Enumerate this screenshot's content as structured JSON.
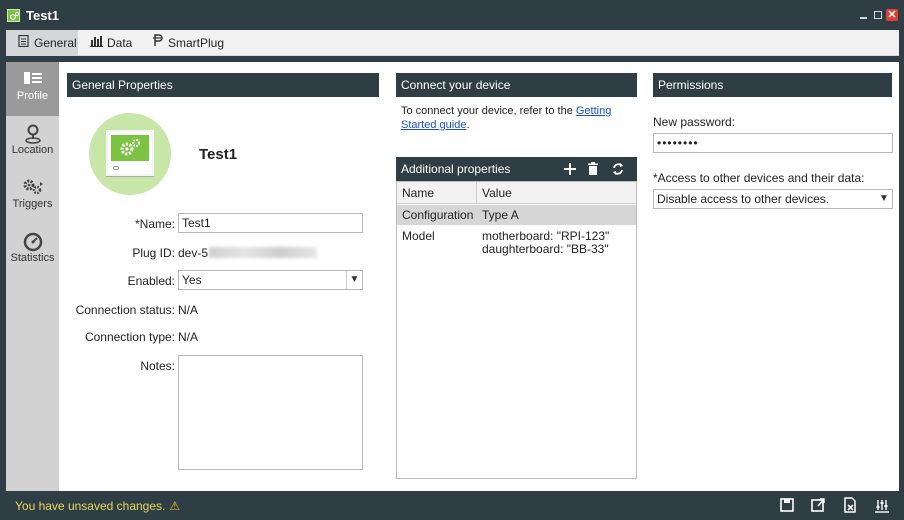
{
  "window": {
    "title": "Test1"
  },
  "top_tabs": [
    {
      "label": "General",
      "icon": "document-icon",
      "active": true
    },
    {
      "label": "Data",
      "icon": "bar-chart-icon",
      "active": false
    },
    {
      "label": "SmartPlug",
      "icon": "smartplug-icon",
      "active": false
    }
  ],
  "sidebar": {
    "items": [
      {
        "label": "Profile",
        "icon": "profile-icon",
        "active": true
      },
      {
        "label": "Location",
        "icon": "location-pin-icon",
        "active": false
      },
      {
        "label": "Triggers",
        "icon": "gears-icon",
        "active": false
      },
      {
        "label": "Statistics",
        "icon": "gauge-icon",
        "active": false
      }
    ]
  },
  "general": {
    "header": "General Properties",
    "device_name": "Test1",
    "name_label": "*Name:",
    "name_value": "Test1",
    "plug_id_label": "Plug ID:",
    "plug_id_value": "dev-5",
    "enabled_label": "Enabled:",
    "enabled_value": "Yes",
    "conn_status_label": "Connection status:",
    "conn_status_value": "N/A",
    "conn_type_label": "Connection type:",
    "conn_type_value": "N/A",
    "notes_label": "Notes:",
    "notes_value": ""
  },
  "connect": {
    "header": "Connect your device",
    "text_before": "To connect your device, refer to the ",
    "link": "Getting Started guide",
    "text_after": "."
  },
  "additional": {
    "header": "Additional properties",
    "columns": [
      "Name",
      "Value"
    ],
    "rows": [
      {
        "name": "Configuration",
        "value_lines": [
          "Type A"
        ]
      },
      {
        "name": "Model",
        "value_lines": [
          "motherboard: \"RPI-123\"",
          "daughterboard: \"BB-33\""
        ]
      }
    ]
  },
  "permissions": {
    "header": "Permissions",
    "password_label": "New password:",
    "password_value": "••••••••",
    "access_label": "*Access to other devices and their data:",
    "access_value": "Disable access to other devices."
  },
  "status": {
    "message": "You have unsaved changes.",
    "warning_icon": "warning-icon",
    "color": "#e8d95a"
  },
  "colors": {
    "chrome": "#2f3d44",
    "accent_green": "#7cc243",
    "link": "#1a4fd6"
  }
}
